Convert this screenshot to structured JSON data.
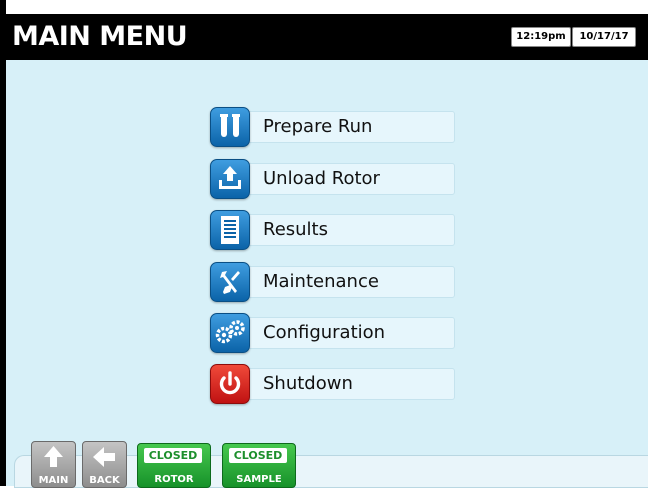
{
  "header": {
    "title": "MAIN MENU",
    "time": "12:19pm",
    "date": "10/17/17"
  },
  "menu": {
    "items": [
      {
        "label": "Prepare Run",
        "icon": "test-tubes-icon"
      },
      {
        "label": "Unload Rotor",
        "icon": "unload-tray-icon"
      },
      {
        "label": "Results",
        "icon": "document-icon"
      },
      {
        "label": "Maintenance",
        "icon": "wrench-screwdriver-icon"
      },
      {
        "label": "Configuration",
        "icon": "gears-icon"
      },
      {
        "label": "Shutdown",
        "icon": "power-icon"
      }
    ]
  },
  "footer": {
    "main_label": "MAIN",
    "back_label": "BACK",
    "rotor": {
      "state": "CLOSED",
      "label": "ROTOR"
    },
    "sample": {
      "state": "CLOSED",
      "label": "SAMPLE"
    }
  },
  "colors": {
    "background": "#d7f0f8",
    "header": "#000000",
    "icon_blue": "#0b63a8",
    "icon_red": "#c01212",
    "status_green": "#17922a"
  }
}
